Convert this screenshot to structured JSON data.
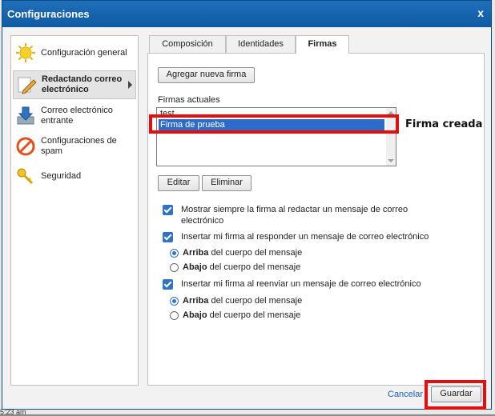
{
  "window": {
    "title": "Configuraciones",
    "close_glyph": "x",
    "background_time": "5:23 am"
  },
  "sidebar": {
    "items": [
      {
        "label_line1": "Configuración general",
        "label_line2": "",
        "icon": "sun-icon"
      },
      {
        "label_line1": "Redactando correo",
        "label_line2": "electrónico",
        "icon": "pencil-icon",
        "selected": true
      },
      {
        "label_line1": "Correo electrónico",
        "label_line2": "entrante",
        "icon": "download-icon"
      },
      {
        "label_line1": "Configuraciones de",
        "label_line2": "spam",
        "icon": "no-entry-icon"
      },
      {
        "label_line1": "Seguridad",
        "label_line2": "",
        "icon": "key-icon"
      }
    ]
  },
  "tabs": [
    {
      "label": "Composición"
    },
    {
      "label": "Identidades"
    },
    {
      "label": "Firmas",
      "active": true
    }
  ],
  "firmas": {
    "add_button": "Agregar nueva firma",
    "list_label": "Firmas actuales",
    "list_items": [
      "test",
      "Firma de prueba"
    ],
    "selected_index": 1,
    "edit_button": "Editar",
    "delete_button": "Eliminar",
    "options": {
      "always_show_line1": "Mostrar siempre la firma al redactar un mensaje de correo",
      "always_show_line2": "electrónico",
      "insert_reply": "Insertar mi firma al responder un mensaje de correo electrónico",
      "insert_forward": "Insertar mi firma al reenviar un mensaje de correo electrónico",
      "above_bold": "Arriba",
      "above_rest": " del cuerpo del mensaje",
      "below_bold": "Abajo",
      "below_rest": " del cuerpo del mensaje"
    }
  },
  "annotation": {
    "text": "Firma creada",
    "color": "#e10f0f"
  },
  "footer": {
    "cancel": "Cancelar",
    "save": "Guardar"
  }
}
